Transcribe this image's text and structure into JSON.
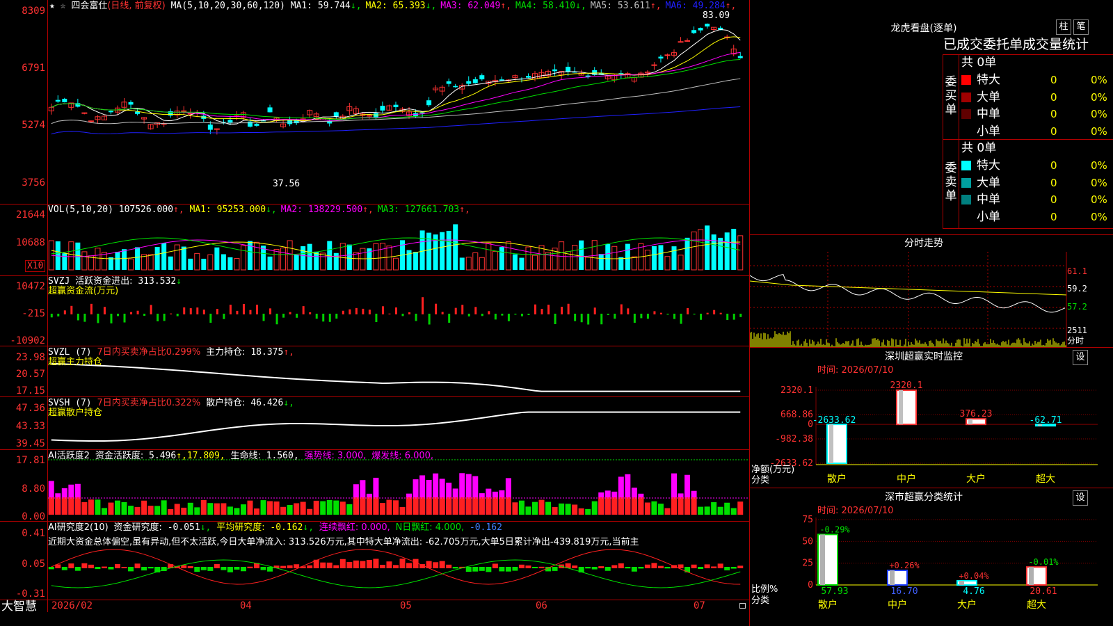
{
  "main": {
    "star_icon": "★",
    "fav_icon": "☆",
    "stock_name": "四会富仕",
    "period": "(日线, 前复权)",
    "ma_params": "MA(5,10,20,30,60,120)",
    "ma": [
      {
        "label": "MA1:",
        "value": "59.744",
        "arrow": "↓",
        "color": "#ffffff"
      },
      {
        "label": "MA2:",
        "value": "65.393",
        "arrow": "↓",
        "color": "#ffff00"
      },
      {
        "label": "MA3:",
        "value": "62.049",
        "arrow": "↑",
        "color": "#ff00ff"
      },
      {
        "label": "MA4:",
        "value": "58.410",
        "arrow": "↓",
        "color": "#00e000"
      },
      {
        "label": "MA5:",
        "value": "53.611",
        "arrow": "↑",
        "color": "#c0c0c0"
      },
      {
        "label": "MA6:",
        "value": "49.284",
        "arrow": "↑",
        "color": "#2020ff"
      }
    ],
    "high_label": "83.09",
    "low_label": "37.56",
    "axis": [
      "8309",
      "6791",
      "5274",
      "3756"
    ]
  },
  "vol": {
    "params": "VOL(5,10,20)",
    "value": "107526.000",
    "ma": [
      {
        "label": "MA1:",
        "value": "95253.000",
        "arrow": "↓",
        "color": "#ffff00"
      },
      {
        "label": "MA2:",
        "value": "138229.500",
        "arrow": "↑",
        "color": "#ff00ff"
      },
      {
        "label": "MA3:",
        "value": "127661.703",
        "arrow": "↑",
        "color": "#00e000"
      }
    ],
    "axis": [
      "21644",
      "10688"
    ],
    "unit": "X10"
  },
  "svzj": {
    "name": "SVZJ",
    "label": "活跃资金进出:",
    "value": "313.532",
    "arrow": "↓",
    "sub": "超赢资金流(万元)",
    "axis": [
      "10472",
      "-215",
      "-10902"
    ]
  },
  "svzl": {
    "name": "SVZL (7)",
    "pct_label": "7日内买卖净占比0.299%",
    "label": "主力持仓:",
    "value": "18.375",
    "arrow": "↑,",
    "sub": "超赢主力持仓",
    "axis": [
      "23.98",
      "20.57",
      "17.15"
    ]
  },
  "svsh": {
    "name": "SVSH (7)",
    "pct_label": "7日内买卖净占比0.322%",
    "label": "散户持仓:",
    "value": "46.426",
    "arrow": "↓,",
    "sub": "超赢散户持仓",
    "axis": [
      "47.36",
      "43.33",
      "39.45"
    ]
  },
  "ai1": {
    "name": "AI活跃度2",
    "label": "资金活跃度:",
    "value": "5.496",
    "v2": "↑,17.809,",
    "life_label": "生命线:",
    "life_value": "1.560,",
    "strong": "强势线: 3.000,",
    "burst": "爆发线: 6.000,",
    "axis": [
      "17.81",
      "8.80",
      "0.00"
    ]
  },
  "ai2": {
    "name": "AI研究度2(10)",
    "label": "资金研究度:",
    "value": "-0.051",
    "arrow": "↓,",
    "avg_label": "平均研究度:",
    "avg_value": "-0.162",
    "streak": "连续飘红: 0.000,",
    "nday": "N日飘红: 4.000,",
    "last": "-0.162",
    "commentary": "近期大资金总体偏空,虽有异动,但不太活跃,今日大单净流入: 313.526万元,其中特大单净流出: -62.705万元,大单5日累计净出-439.819万元,当前主",
    "axis": [
      "0.41",
      "0.05",
      "-0.31"
    ]
  },
  "bottom": {
    "brand": "大智慧",
    "dates": [
      "2026/02",
      "04",
      "05",
      "06",
      "07"
    ]
  },
  "dragon": {
    "title": "龙虎看盘(逐单)",
    "btn1": "柱",
    "btn2": "笔",
    "subtitle": "已成交委托单成交量统计",
    "buy_side": "委买单",
    "sell_side": "委卖单",
    "buy_total": "共 0单",
    "sell_total": "共 0单",
    "buy_rows": [
      {
        "name": "特大",
        "count": "0",
        "pct": "0%",
        "color": "#ff0000"
      },
      {
        "name": "大单",
        "count": "0",
        "pct": "0%",
        "color": "#a00000"
      },
      {
        "name": "中单",
        "count": "0",
        "pct": "0%",
        "color": "#600000"
      },
      {
        "name": "小单",
        "count": "0",
        "pct": "0%",
        "color": "#000000"
      }
    ],
    "sell_rows": [
      {
        "name": "特大",
        "count": "0",
        "pct": "0%",
        "color": "#00ffff"
      },
      {
        "name": "大单",
        "count": "0",
        "pct": "0%",
        "color": "#00a0a0"
      },
      {
        "name": "中单",
        "count": "0",
        "pct": "0%",
        "color": "#008080"
      },
      {
        "name": "小单",
        "count": "0",
        "pct": "0%",
        "color": "#000000"
      }
    ]
  },
  "fenshi": {
    "title": "分时走势",
    "axis": [
      "61.1",
      "59.2",
      "57.2",
      "2511",
      "分时"
    ]
  },
  "monitor": {
    "title": "深圳超赢实时监控",
    "settings": "设",
    "time": "时间: 2026/07/10",
    "axis": [
      "2320.1",
      "668.86",
      "0",
      "-982.38",
      "-2633.62"
    ],
    "ylabel": "净额(万元)",
    "xlabel": "分类",
    "bars": [
      {
        "cat": "散户",
        "value": -2633.62,
        "label": "-2633.62",
        "color": "#00ffff"
      },
      {
        "cat": "中户",
        "value": 2320.1,
        "label": "2320.1",
        "color": "#ff3232"
      },
      {
        "cat": "大户",
        "value": 376.23,
        "label": "376.23",
        "color": "#ff3232"
      },
      {
        "cat": "超大",
        "value": -62.71,
        "label": "-62.71",
        "color": "#00ffff"
      }
    ]
  },
  "classify": {
    "title": "深市超赢分类统计",
    "settings": "设",
    "time": "时间: 2026/07/10",
    "axis": [
      "75",
      "50",
      "25",
      "0"
    ],
    "ylabel": "比例%",
    "xlabel": "分类",
    "bars": [
      {
        "cat": "散户",
        "value": 57.93,
        "label": "57.93",
        "change": "-0.29%",
        "change_color": "#00e000",
        "color": "#00e000"
      },
      {
        "cat": "中户",
        "value": 16.7,
        "label": "16.70",
        "change": "+0.26%",
        "change_color": "#ff3232",
        "color": "#2040ff"
      },
      {
        "cat": "大户",
        "value": 4.76,
        "label": "4.76",
        "change": "+0.04%",
        "change_color": "#ff3232",
        "color": "#00ffff"
      },
      {
        "cat": "超大",
        "value": 20.61,
        "label": "20.61",
        "change": "-0.01%",
        "change_color": "#00e000",
        "color": "#ff3232"
      }
    ]
  }
}
